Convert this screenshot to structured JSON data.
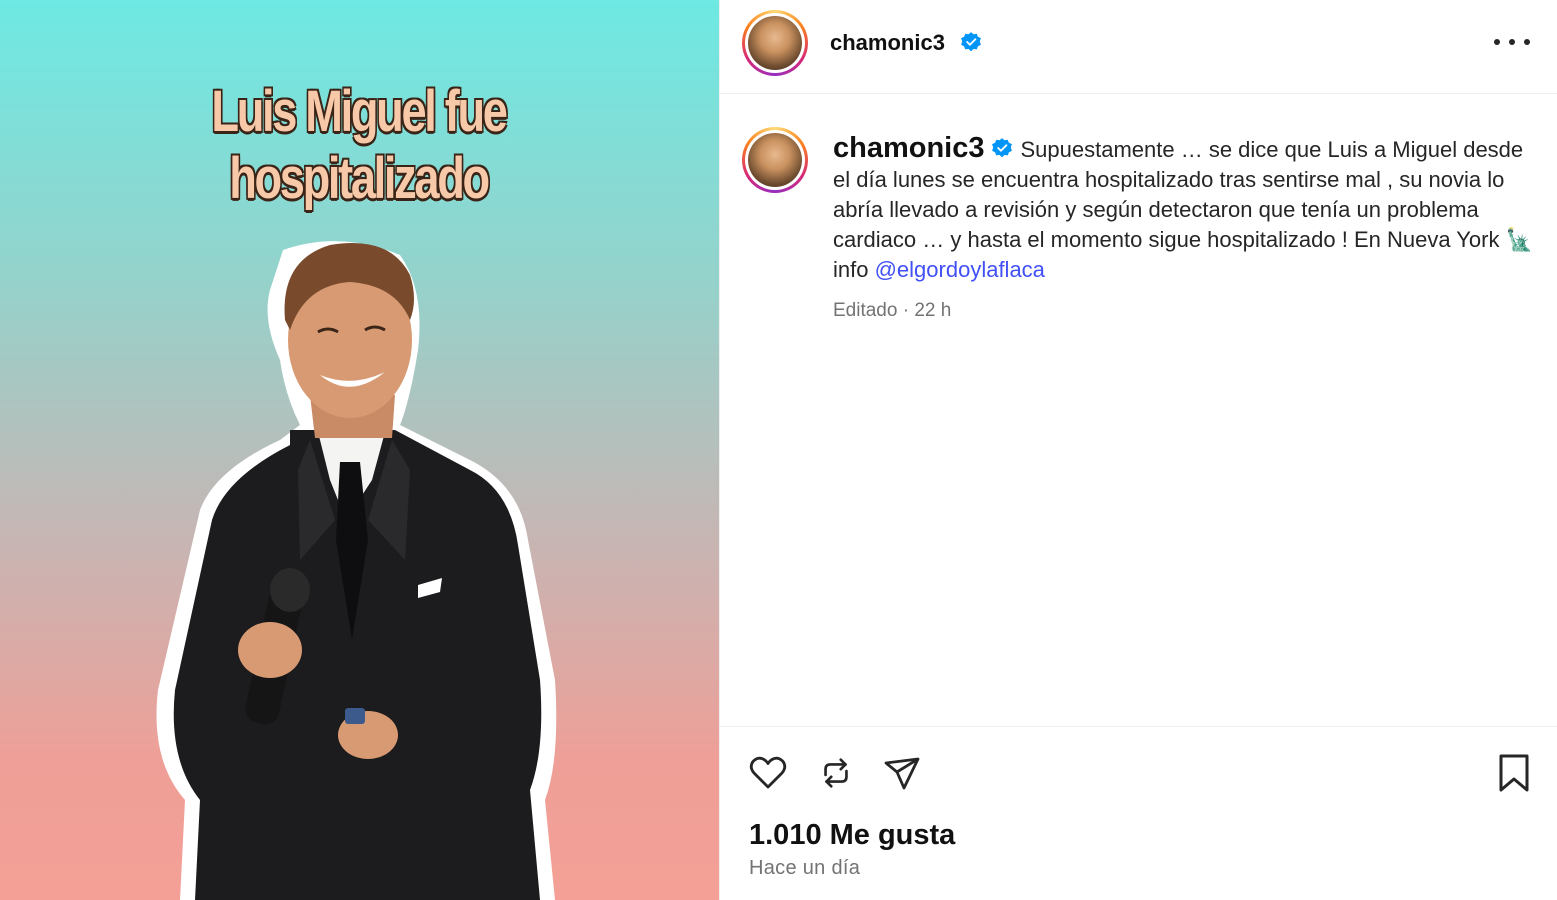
{
  "media": {
    "headline": "Luis Miguel fue hospitalizado"
  },
  "header": {
    "username": "chamonic3",
    "verified": true
  },
  "caption": {
    "username": "chamonic3",
    "text_before_mention": "Supuestamente … se dice que Luis a Miguel desde el día lunes se encuentra hospitalizado tras sentirse mal , su novia lo abría llevado a revisión y según detectaron que tenía un problema cardiaco … y hasta el momento sigue hospitalizado ! En Nueva York 🗽 info ",
    "mention": "@elgordoylaflaca",
    "edited_label": "Editado",
    "separator": "·",
    "time": "22 h"
  },
  "actions": {
    "icons": [
      "heart-icon",
      "repost-icon",
      "share-icon",
      "bookmark-icon"
    ],
    "likes": "1.010 Me gusta",
    "posted": "Hace un día"
  },
  "colors": {
    "mention": "#4150f7",
    "verified": "#0095f6",
    "gradient_top": "#6ee9e3",
    "gradient_bottom": "#f4a097"
  }
}
